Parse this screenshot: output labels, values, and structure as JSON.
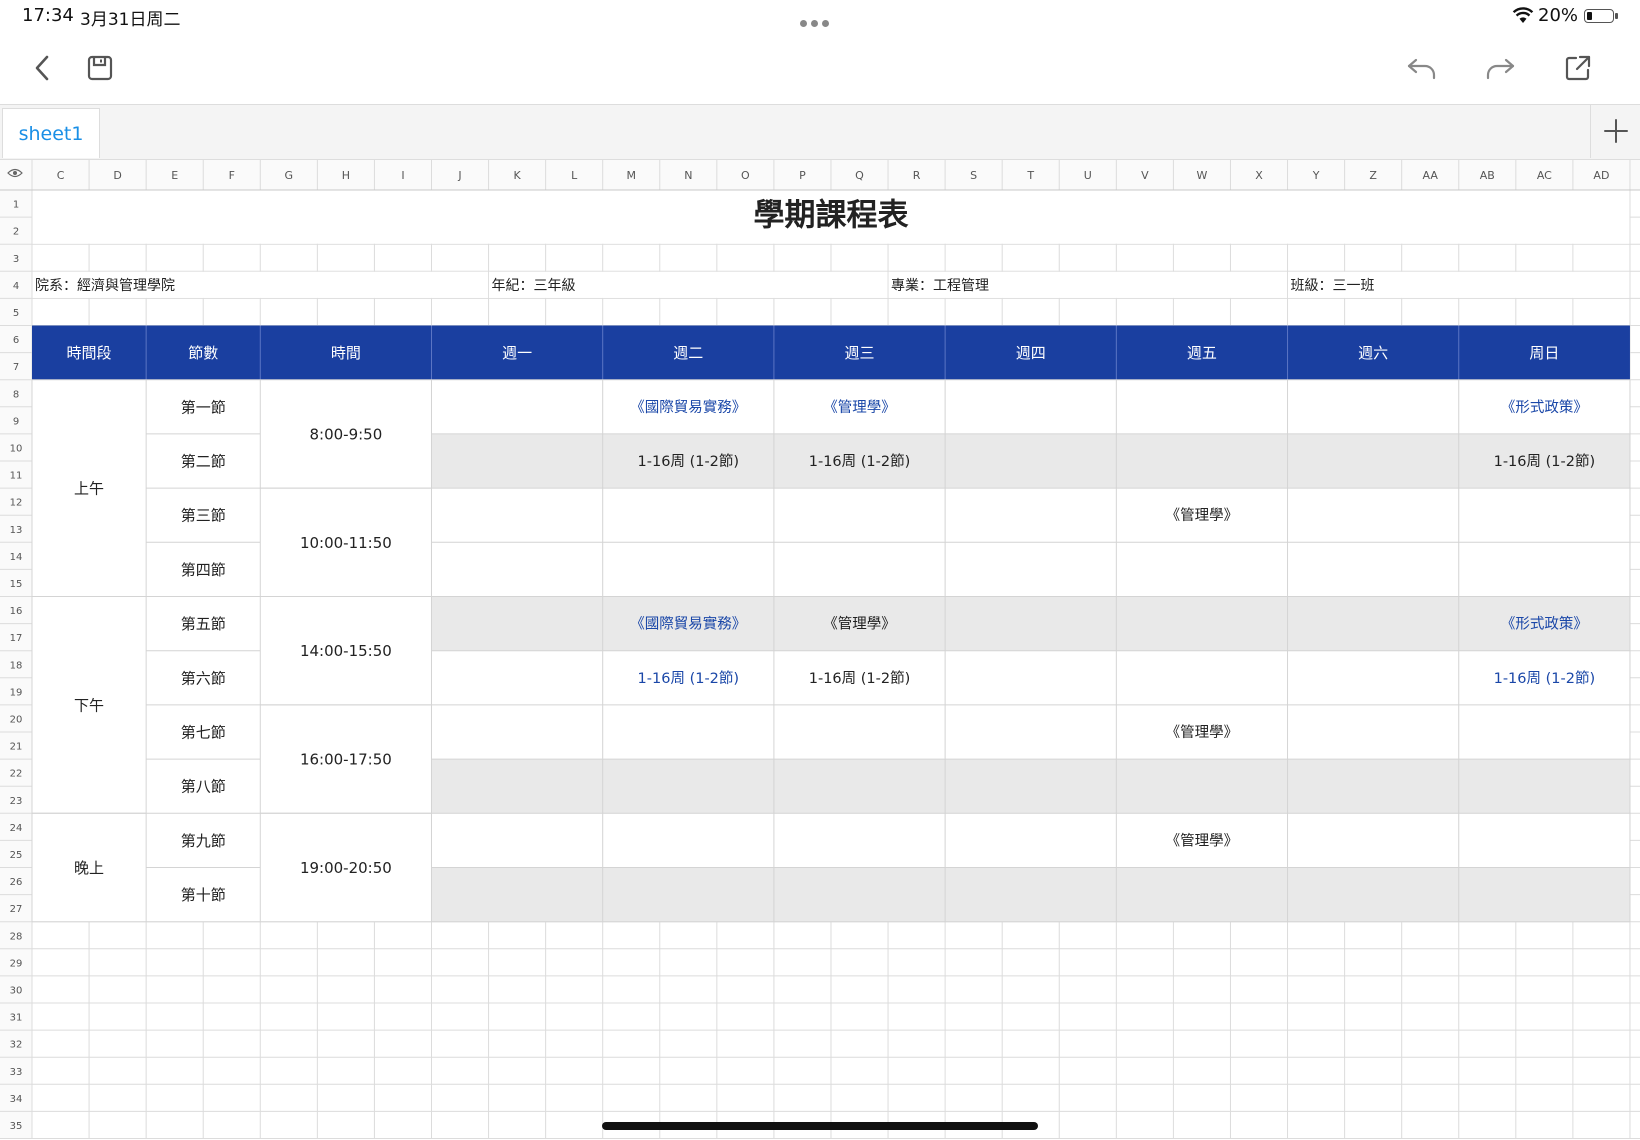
{
  "status_bar": {
    "time": "17:34",
    "date": "3月31日周二",
    "battery_percent": "20%",
    "battery_level": 0.2
  },
  "toolbar": {
    "back_icon": "chevron-left-icon",
    "save_icon": "floppy-disk-icon",
    "undo_icon": "undo-icon",
    "redo_icon": "redo-icon",
    "share_icon": "share-icon"
  },
  "tabs": {
    "sheet": "sheet1",
    "add": "+"
  },
  "sheet": {
    "columns": [
      "C",
      "D",
      "E",
      "F",
      "G",
      "H",
      "I",
      "J",
      "K",
      "L",
      "M",
      "N",
      "O",
      "P",
      "Q",
      "R",
      "S",
      "T",
      "U",
      "V",
      "W",
      "X",
      "Y",
      "Z",
      "AA",
      "AB",
      "AC",
      "AD"
    ],
    "rows": [
      "1",
      "2",
      "3",
      "4",
      "5",
      "6",
      "7",
      "8",
      "9",
      "10",
      "11",
      "12",
      "13",
      "14",
      "15",
      "16",
      "17",
      "18",
      "19",
      "20",
      "21",
      "22",
      "23",
      "24",
      "25",
      "26",
      "27",
      "28",
      "29",
      "30",
      "31",
      "32",
      "33",
      "34",
      "35"
    ],
    "title": "學期課程表",
    "info": {
      "department": "院系：經濟與管理學院",
      "grade": "年紀：三年級",
      "major": "專業：工程管理",
      "class": "班級：三一班"
    },
    "header": [
      "時間段",
      "節數",
      "時間",
      "週一",
      "週二",
      "週三",
      "週四",
      "週五",
      "週六",
      "周日"
    ],
    "sessions": [
      {
        "label": "上午",
        "periods": [
          "第一節",
          "第二節",
          "第三節",
          "第四節"
        ],
        "times": [
          "8:00-9:50",
          "10:00-11:50"
        ]
      },
      {
        "label": "下午",
        "periods": [
          "第五節",
          "第六節",
          "第七節",
          "第八節"
        ],
        "times": [
          "14:00-15:50",
          "16:00-17:50"
        ]
      },
      {
        "label": "晚上",
        "periods": [
          "第九節",
          "第十節"
        ],
        "times": [
          "19:00-20:50"
        ]
      }
    ],
    "course_cells": [
      {
        "period": 0,
        "day": 1,
        "text": "《國際貿易實務》",
        "color": "#1a47a8"
      },
      {
        "period": 0,
        "day": 2,
        "text": "《管理學》",
        "color": "#1a47a8"
      },
      {
        "period": 0,
        "day": 6,
        "text": "《形式政策》",
        "color": "#1a47a8"
      },
      {
        "period": 1,
        "day": 1,
        "text": "1-16周 (1-2節)",
        "color": "#222222"
      },
      {
        "period": 1,
        "day": 2,
        "text": "1-16周 (1-2節)",
        "color": "#222222"
      },
      {
        "period": 1,
        "day": 6,
        "text": "1-16周 (1-2節)",
        "color": "#222222"
      },
      {
        "period": 2,
        "day": 4,
        "text": "《管理學》",
        "color": "#222222"
      },
      {
        "period": 4,
        "day": 1,
        "text": "《國際貿易實務》",
        "color": "#1a47a8"
      },
      {
        "period": 4,
        "day": 2,
        "text": "《管理學》",
        "color": "#222222"
      },
      {
        "period": 4,
        "day": 6,
        "text": "《形式政策》",
        "color": "#1a47a8"
      },
      {
        "period": 5,
        "day": 1,
        "text": "1-16周 (1-2節)",
        "color": "#1a47a8"
      },
      {
        "period": 5,
        "day": 2,
        "text": "1-16周 (1-2節)",
        "color": "#222222"
      },
      {
        "period": 5,
        "day": 6,
        "text": "1-16周 (1-2節)",
        "color": "#1a47a8"
      },
      {
        "period": 6,
        "day": 4,
        "text": "《管理學》",
        "color": "#222222"
      },
      {
        "period": 8,
        "day": 4,
        "text": "《管理學》",
        "color": "#222222"
      }
    ],
    "shaded_periods": [
      1,
      4,
      7,
      9
    ],
    "colors": {
      "header_bg": "#1a3fa0",
      "header_text": "#ffffff",
      "shade": "#e9e9e9",
      "grid_line": "#dcdcdc"
    }
  }
}
